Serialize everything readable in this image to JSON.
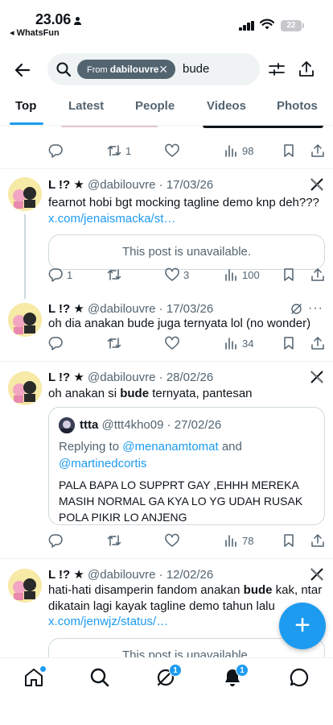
{
  "status_bar": {
    "time": "23.06",
    "back_app": "◂ WhatsFun",
    "battery": "22"
  },
  "search": {
    "chip_prefix": "From",
    "chip_user": "dabilouvre",
    "chip_remove": "✕",
    "query": "bude"
  },
  "tabs": [
    "Top",
    "Latest",
    "People",
    "Videos",
    "Photos"
  ],
  "active_tab": "Top",
  "top_partial_actions": {
    "replies": "",
    "reposts": "1",
    "likes": "",
    "views": "98"
  },
  "tweets": [
    {
      "name": "L !? ★",
      "handle": "@dabilouvre",
      "date": "17/03/26",
      "text": "fearnot hobi bgt mocking tagline demo knp deh???",
      "link": "x.com/jenaismacka/st…",
      "unavailable": "This post is unavailable.",
      "replies": "1",
      "reposts": "",
      "likes": "3",
      "views": "100"
    },
    {
      "name": "L !? ★",
      "handle": "@dabilouvre",
      "date": "17/03/26",
      "text": "oh dia anakan bude juga ternyata lol (no wonder)",
      "more": "···",
      "replies": "",
      "reposts": "",
      "likes": "",
      "views": "34"
    },
    {
      "name": "L !? ★",
      "handle": "@dabilouvre",
      "date": "28/02/26",
      "text_before": "oh anakan si ",
      "text_bold": "bude",
      "text_after": " ternyata, pantesan",
      "quote": {
        "name": "ttta",
        "handle": "@ttt4kho09",
        "date": "27/02/26",
        "replying_prefix": "Replying to ",
        "mention1": "@menanamtomat",
        "and": " and ",
        "mention2": "@martinedcortis",
        "text": "PALA BAPA LO SUPPRT GAY ,EHHH MEREKA MASIH NORMAL GA KYA LO YG UDAH RUSAK POLA PIKIR LO ANJENG"
      },
      "replies": "",
      "reposts": "",
      "likes": "",
      "views": "78"
    },
    {
      "name": "L !? ★",
      "handle": "@dabilouvre",
      "date": "12/02/26",
      "text_before": "hati-hati disamperin fandom anakan ",
      "text_bold": "bude",
      "text_after": " kak, ntar dikatain lagi kayak tagline demo tahun lalu",
      "link": "x.com/jenwjz/status/…",
      "unavailable": "This post is unavailable."
    }
  ],
  "separator": " · ",
  "fab_label": "+",
  "bottom_nav": {
    "grok_badge": "1",
    "notifications_badge": "1"
  },
  "colors": {
    "accent": "#1d9bf0",
    "text": "#0f1419",
    "secondary": "#536471",
    "border": "#cfd9de"
  }
}
